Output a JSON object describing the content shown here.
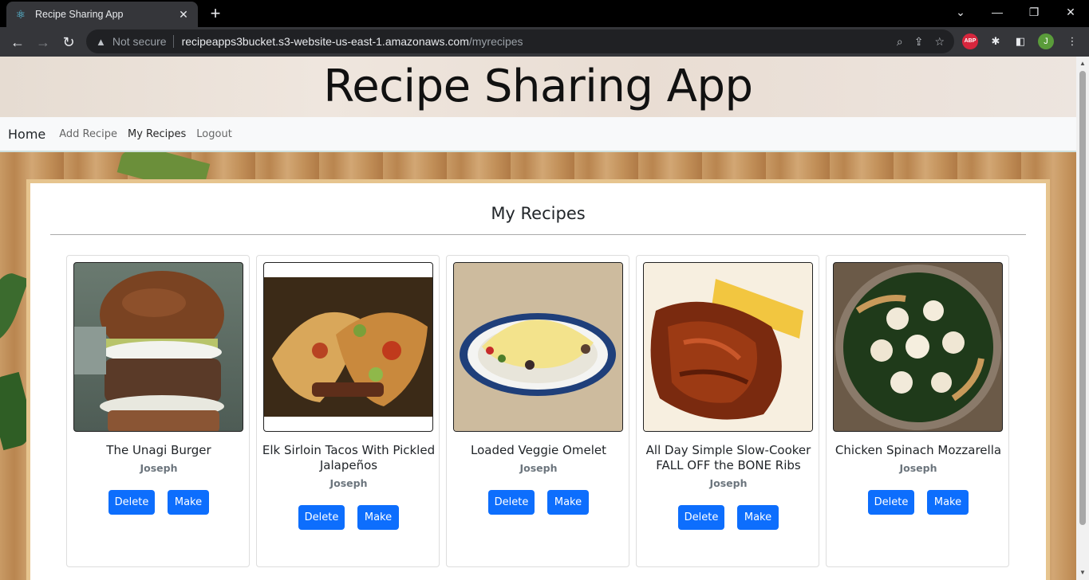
{
  "browser": {
    "tab_title": "Recipe Sharing App",
    "security_label": "Not secure",
    "url_host": "recipeapps3bucket.s3-website-us-east-1.amazonaws.com",
    "url_path": "/myrecipes",
    "profile_initial": "J",
    "abp_label": "ABP"
  },
  "header": {
    "title": "Recipe Sharing App"
  },
  "navbar": {
    "brand": "Home",
    "links": [
      "Add Recipe",
      "My Recipes",
      "Logout"
    ]
  },
  "main": {
    "heading": "My Recipes",
    "recipes": [
      {
        "name": "The Unagi Burger",
        "author": "Joseph",
        "delete_label": "Delete",
        "make_label": "Make"
      },
      {
        "name": "Elk Sirloin Tacos With Pickled Jalapeños",
        "author": "Joseph",
        "delete_label": "Delete",
        "make_label": "Make"
      },
      {
        "name": "Loaded Veggie Omelet",
        "author": "Joseph",
        "delete_label": "Delete",
        "make_label": "Make"
      },
      {
        "name": "All Day Simple Slow-Cooker FALL OFF the BONE Ribs",
        "author": "Joseph",
        "delete_label": "Delete",
        "make_label": "Make"
      },
      {
        "name": "Chicken Spinach Mozzarella",
        "author": "Joseph",
        "delete_label": "Delete",
        "make_label": "Make"
      }
    ]
  },
  "colors": {
    "primary_button": "#0d6efd",
    "panel_border": "#e6c48e",
    "navbar_bg": "#f8f9fa"
  }
}
